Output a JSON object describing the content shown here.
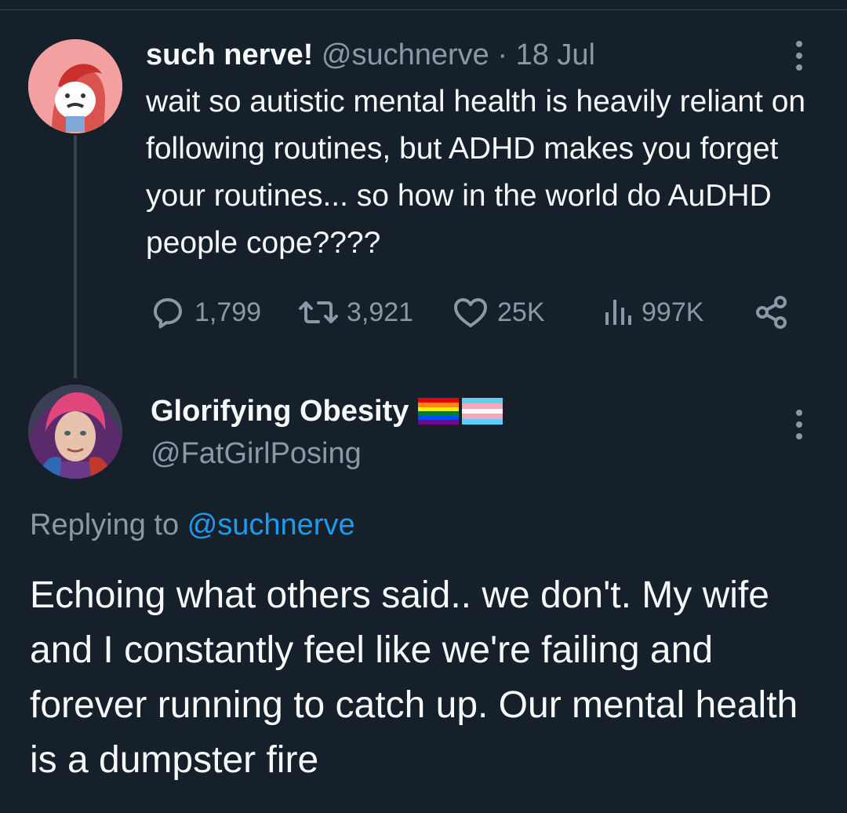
{
  "tweet": {
    "display_name": "such nerve!",
    "handle": "@suchnerve",
    "separator": "·",
    "date": "18 Jul",
    "text": "wait so autistic mental health is heavily reliant on following routines, but ADHD makes you forget your routines... so how in the world do AuDHD people cope????",
    "stats": {
      "replies": "1,799",
      "retweets": "3,921",
      "likes": "25K",
      "views": "997K"
    },
    "avatar_color": "#f2a0a0"
  },
  "reply": {
    "display_name": "Glorifying Obesity",
    "flags": [
      "rainbow-flag-icon",
      "transgender-flag-icon"
    ],
    "handle": "@FatGirlPosing",
    "replying_prefix": "Replying to",
    "replying_handle": "@suchnerve",
    "text": "Echoing what others said.. we don't. My wife and I constantly feel like we're failing and forever running to catch up. Our mental health is a dumpster fire"
  },
  "colors": {
    "background": "#15202b",
    "text": "#f7f9f9",
    "muted": "#8b98a5",
    "link": "#1d9bf0",
    "divider": "#38444d"
  }
}
